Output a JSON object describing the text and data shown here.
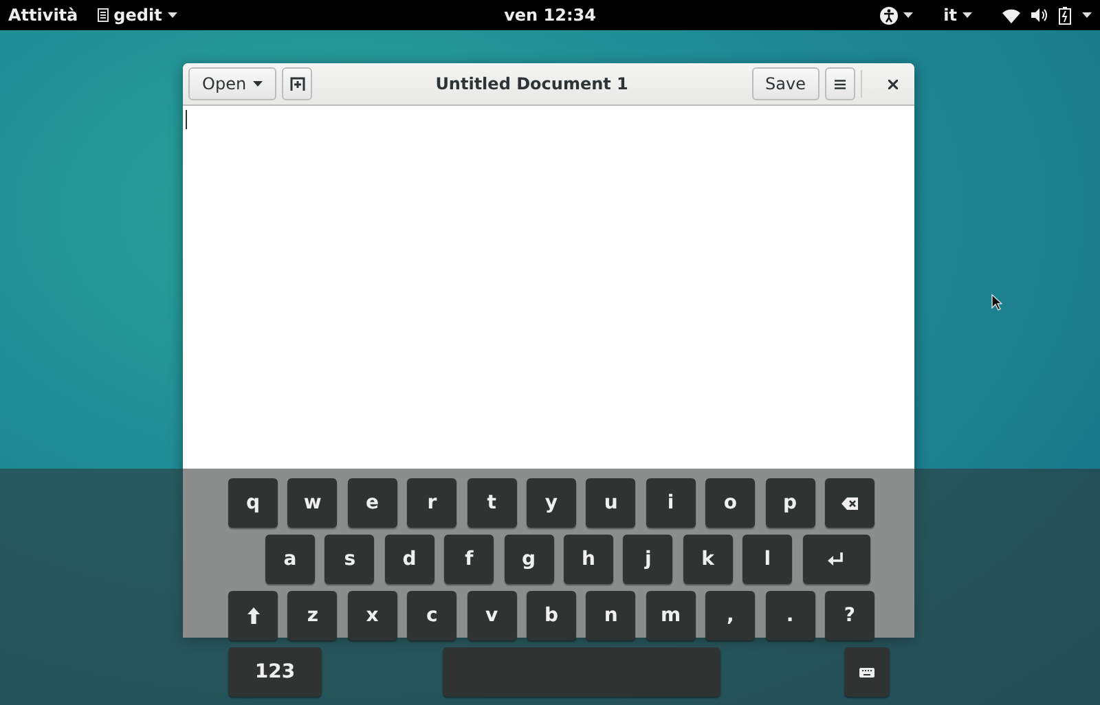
{
  "top_bar": {
    "activities": "Attività",
    "app_menu": "gedit",
    "clock": "ven 12:34",
    "input_source": "it"
  },
  "window": {
    "open_button": "Open",
    "title": "Untitled Document 1",
    "save_button": "Save"
  },
  "keyboard": {
    "rows": [
      [
        {
          "kind": "char",
          "label": "q"
        },
        {
          "kind": "char",
          "label": "w"
        },
        {
          "kind": "char",
          "label": "e"
        },
        {
          "kind": "char",
          "label": "r"
        },
        {
          "kind": "char",
          "label": "t"
        },
        {
          "kind": "char",
          "label": "y"
        },
        {
          "kind": "char",
          "label": "u"
        },
        {
          "kind": "char",
          "label": "i"
        },
        {
          "kind": "char",
          "label": "o"
        },
        {
          "kind": "char",
          "label": "p"
        },
        {
          "kind": "backspace"
        }
      ],
      [
        {
          "kind": "char",
          "label": "a"
        },
        {
          "kind": "char",
          "label": "s"
        },
        {
          "kind": "char",
          "label": "d"
        },
        {
          "kind": "char",
          "label": "f"
        },
        {
          "kind": "char",
          "label": "g"
        },
        {
          "kind": "char",
          "label": "h"
        },
        {
          "kind": "char",
          "label": "j"
        },
        {
          "kind": "char",
          "label": "k"
        },
        {
          "kind": "char",
          "label": "l"
        },
        {
          "kind": "enter"
        }
      ],
      [
        {
          "kind": "shift"
        },
        {
          "kind": "char",
          "label": "z"
        },
        {
          "kind": "char",
          "label": "x"
        },
        {
          "kind": "char",
          "label": "c"
        },
        {
          "kind": "char",
          "label": "v"
        },
        {
          "kind": "char",
          "label": "b"
        },
        {
          "kind": "char",
          "label": "n"
        },
        {
          "kind": "char",
          "label": "m"
        },
        {
          "kind": "char",
          "label": ","
        },
        {
          "kind": "char",
          "label": "."
        },
        {
          "kind": "char",
          "label": "?"
        }
      ],
      [
        {
          "kind": "mode",
          "label": "123"
        },
        {
          "kind": "space"
        },
        {
          "kind": "hide"
        }
      ]
    ]
  }
}
